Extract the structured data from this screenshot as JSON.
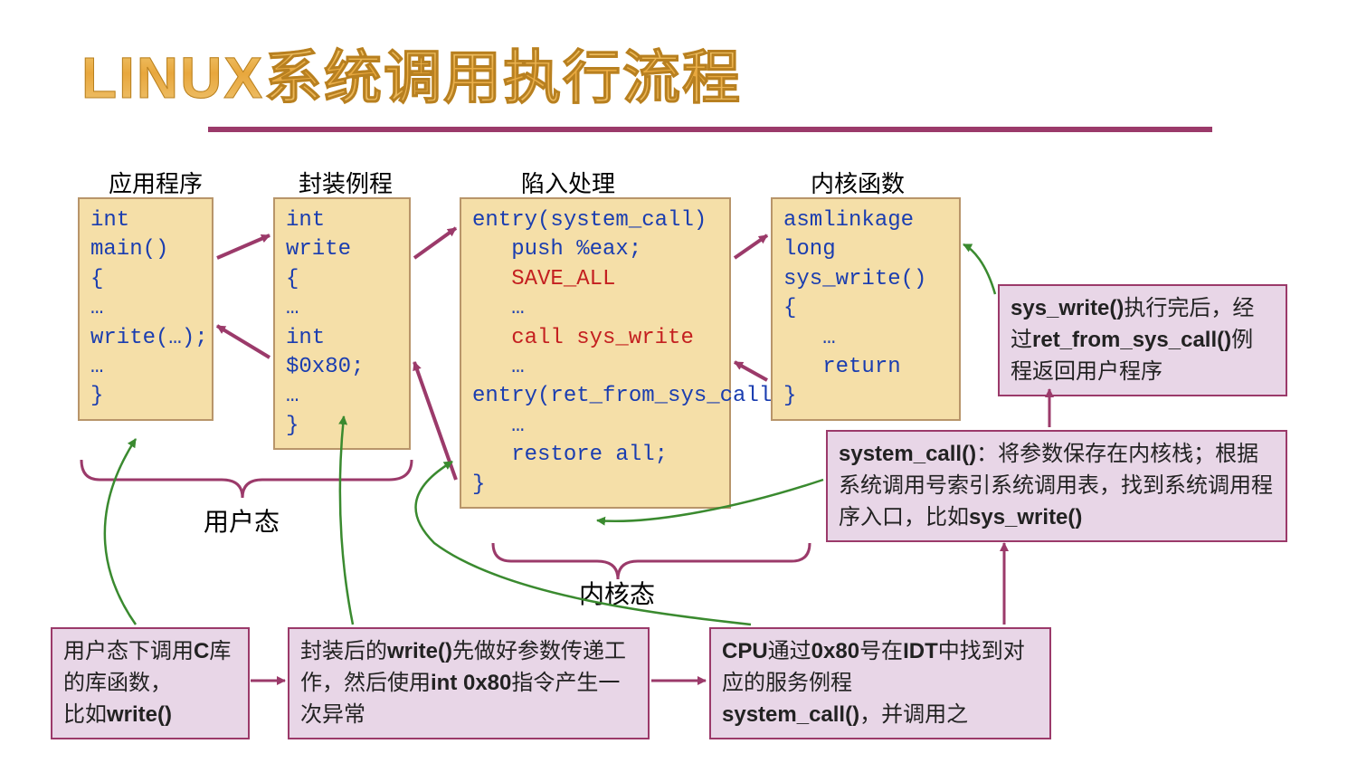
{
  "title": "LINUX系统调用执行流程",
  "columns": {
    "app": "应用程序",
    "wrapper": "封装例程",
    "trap": "陷入处理",
    "kernel": "内核函数"
  },
  "code": {
    "app_l1": "int main()",
    "app_l2": "{",
    "app_l3": "…",
    "app_l4": "write(…);",
    "app_l5": "…",
    "app_l6": " ",
    "app_l7": "}",
    "wrap_l1": "int write",
    "wrap_l2": "{",
    "wrap_l3": "…",
    "wrap_l4": "int $0x80;",
    "wrap_l5": "…",
    "wrap_l6": " ",
    "wrap_l7": "}",
    "trap_l1": "entry(system_call)",
    "trap_l2": "   push %eax;",
    "trap_l3": "   SAVE_ALL",
    "trap_l4": "   …",
    "trap_l5": "   call sys_write",
    "trap_l6": "   …",
    "trap_l7": "entry(ret_from_sys_call)",
    "trap_l8": "   …",
    "trap_l9": "   restore all;",
    "trap_l10": " ",
    "trap_l11": "}",
    "kern_l1": "asmlinkage long",
    "kern_l2": "sys_write()",
    "kern_l3": "{",
    "kern_l4": "   …",
    "kern_l5": "   return",
    "kern_l6": " ",
    "kern_l7": "}"
  },
  "modes": {
    "user": "用户态",
    "kernel": "内核态"
  },
  "desc": {
    "box1_a": "用户态下调用",
    "box1_b": "C",
    "box1_c": "库的库函数，",
    "box1_d": "比如",
    "box1_e": "write()",
    "box2_a": "封装后的",
    "box2_b": "write()",
    "box2_c": "先做好参数传递工作，然后使用",
    "box2_d": "int 0x80",
    "box2_e": "指令产生一次异常",
    "box3_a": "CPU",
    "box3_b": "通过",
    "box3_c": "0x80",
    "box3_d": "号在",
    "box3_e": "IDT",
    "box3_f": "中找到对应的服务例程",
    "box3_g": "system_call()",
    "box3_h": "，并调用之",
    "box4_a": "system_call()",
    "box4_b": "：将参数保存在内核栈；根据系统调用号索引系统调用表，找到系统调用程序入口，比如",
    "box4_c": "sys_write()",
    "box5_a": "sys_write()",
    "box5_b": "执行完后，经过",
    "box5_c": "ret_from_sys_call()",
    "box5_d": "例程返回用户程序"
  }
}
